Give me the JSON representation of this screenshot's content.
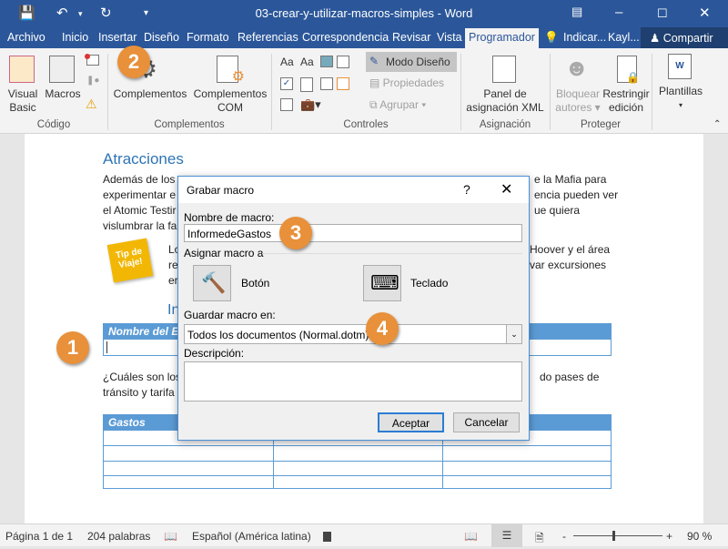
{
  "window": {
    "title": "03-crear-y-utilizar-macros-simples  -  Word",
    "icons": [
      "save-icon",
      "undo-icon",
      "redo-icon",
      "customize-qat-icon",
      "ribbon-display-icon",
      "minimize-icon",
      "maximize-icon",
      "close-icon"
    ]
  },
  "tabs": [
    "Archivo",
    "Inicio",
    "Insertar",
    "Diseño",
    "Formato",
    "Referencias",
    "Correspondencia",
    "Revisar",
    "Vista",
    "Programador"
  ],
  "active_tab": "Programador",
  "tell_me": "Indicar...",
  "user": "Kayl...",
  "share": "Compartir",
  "ribbon": {
    "codigo": {
      "label": "Código",
      "visual_basic": [
        "Visual",
        "Basic"
      ],
      "macros": "Macros"
    },
    "complementos": {
      "label": "Complementos",
      "complementos": "Complementos",
      "com": [
        "Complementos",
        "COM"
      ]
    },
    "controles": {
      "label": "Controles",
      "modo_diseno": "Modo Diseño",
      "propiedades": "Propiedades",
      "agrupar": "Agrupar"
    },
    "asignacion": {
      "label": "Asignación",
      "panel": [
        "Panel de",
        "asignación XML"
      ]
    },
    "proteger": {
      "label": "Proteger",
      "bloquear": [
        "Bloquear",
        "autores"
      ],
      "restringir": [
        "Restringir",
        "edición"
      ]
    },
    "plantillas": {
      "label": "Plantillas"
    }
  },
  "document": {
    "heading": "Atracciones",
    "lines": [
      "Además de los",
      "experimentar e",
      "el Atomic Testir",
      "vislumbrar la fa"
    ],
    "lines_right": [
      "e la Mafia para",
      "encia pueden ver",
      "ue quiera"
    ],
    "tip": [
      "Tip de",
      "Viaje!"
    ],
    "para2_left": [
      "Lo",
      "re",
      "er"
    ],
    "para2_right": [
      "Hoover y el área",
      "var excursiones"
    ],
    "heading2": "In",
    "table1_header": "Nombre del Er",
    "para3_left": [
      "¿Cuáles son los",
      "tránsito y tarifa"
    ],
    "para3_right": "do pases de",
    "table2_header": "Gastos"
  },
  "dialog": {
    "title": "Grabar macro",
    "help": "?",
    "name_label": "Nombre de macro:",
    "name_value": "InformedeGastos",
    "assign_label": "Asignar macro a",
    "button_label": "Botón",
    "keyboard_label": "Teclado",
    "store_label": "Guardar macro en:",
    "store_value": "Todos los documentos (Normal.dotm)",
    "desc_label": "Descripción:",
    "desc_value": "",
    "ok": "Aceptar",
    "cancel": "Cancelar"
  },
  "callouts": [
    "1",
    "2",
    "3",
    "4"
  ],
  "status": {
    "page": "Página 1 de 1",
    "words": "204 palabras",
    "language": "Español (América latina)",
    "zoom": "90 %",
    "zoom_minus": "-",
    "zoom_plus": "+"
  },
  "colors": {
    "brand": "#2b579a",
    "callout": "#e8903a",
    "table_header": "#5b9bd5",
    "heading": "#2e74b5"
  }
}
